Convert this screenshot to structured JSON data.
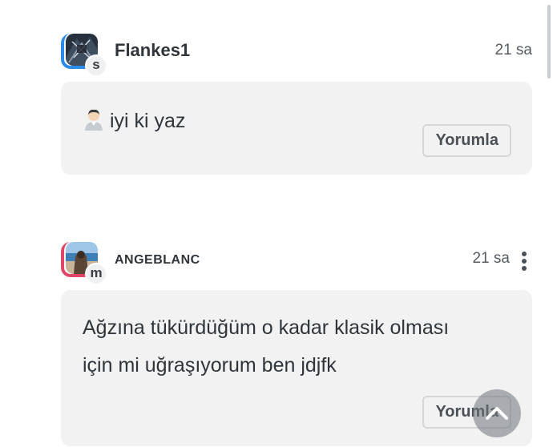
{
  "comments": [
    {
      "username": "Flankes1",
      "level": "s",
      "time": "21 sa",
      "ring_color": "#2b8be8",
      "emoji": "person-emoji",
      "text": "iyi ki yaz",
      "reply_label": "Yorumla"
    },
    {
      "username": "ANGEBLANC",
      "level": "m",
      "time": "21 sa",
      "ring_color": "#e2456a",
      "text": "Ağzına tükürdüğüm o kadar klasik olması için mi uğraşıyorum ben jdjfk",
      "reply_label": "Yorumla",
      "menu_icon": "more-vertical-icon"
    }
  ],
  "scroll_top_icon": "chevron-up-icon"
}
